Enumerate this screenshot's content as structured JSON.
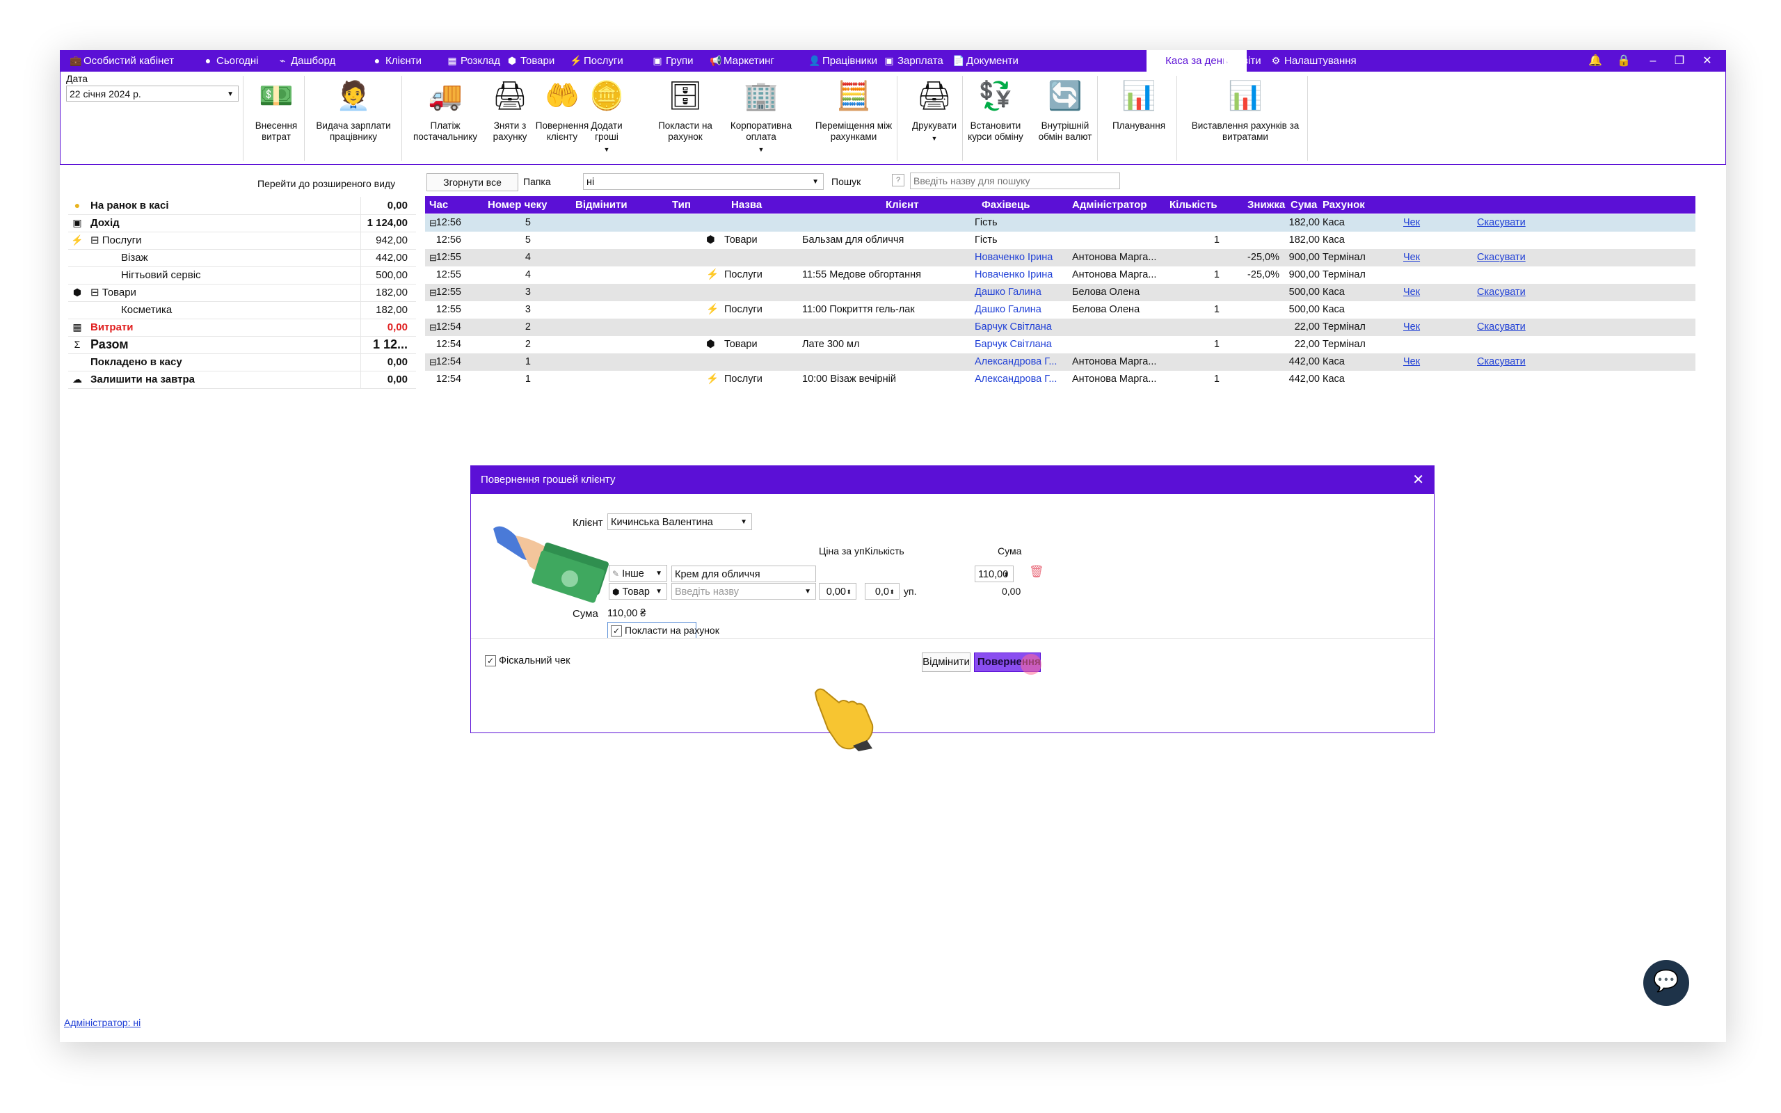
{
  "menubar": {
    "items": [
      {
        "icon": "briefcase-icon",
        "glyph": "💼",
        "label": "Особистий кабінет"
      },
      {
        "icon": "today-icon",
        "glyph": "●",
        "label": "Сьогодні"
      },
      {
        "icon": "pulse-icon",
        "glyph": "⌁",
        "label": "Дашборд"
      },
      {
        "icon": "user-circle-icon",
        "glyph": "●",
        "label": "Клієнти"
      },
      {
        "icon": "calendar-icon",
        "glyph": "▦",
        "label": "Розклад"
      },
      {
        "icon": "box-icon",
        "glyph": "⬢",
        "label": "Товари"
      },
      {
        "icon": "lightning-icon",
        "glyph": "⚡",
        "label": "Послуги"
      },
      {
        "icon": "groups-icon",
        "glyph": "▣",
        "label": "Групи"
      },
      {
        "icon": "megaphone-icon",
        "glyph": "📢",
        "label": "Маркетинг"
      },
      {
        "icon": "person-icon",
        "glyph": "👤",
        "label": "Працівники"
      },
      {
        "icon": "money-icon",
        "glyph": "▣",
        "label": "Зарплата"
      },
      {
        "icon": "document-icon",
        "glyph": "📄",
        "label": "Документи"
      },
      {
        "icon": "",
        "glyph": "",
        "label": "Каса за день"
      },
      {
        "icon": "bar-chart-icon",
        "glyph": "▮▮",
        "label": "Звіти"
      },
      {
        "icon": "gear-icon",
        "glyph": "⚙",
        "label": "Налаштування"
      }
    ],
    "active_index": 12
  },
  "toolbar": {
    "date_label": "Дата",
    "date_value": "22 січня 2024 р.",
    "buttons": [
      {
        "name": "add-expense-button",
        "icon": "cash-icon",
        "glyph": "💵",
        "label": "Внесення витрат",
        "caret": false
      },
      {
        "name": "pay-salary-button",
        "icon": "worker-pay-icon",
        "glyph": "🧑‍💼",
        "label": "Видача зарплати працівнику",
        "caret": false
      },
      {
        "name": "supplier-payment-button",
        "icon": "truck-icon",
        "glyph": "🚚",
        "label": "Платіж постачальнику",
        "caret": false
      },
      {
        "name": "withdraw-button",
        "icon": "register-icon",
        "glyph": "🖨",
        "label": "Зняти з рахунку",
        "caret": false
      },
      {
        "name": "refund-client-button",
        "icon": "refund-hand-icon",
        "glyph": "🤲",
        "label": "Повернення клієнту",
        "caret": false
      },
      {
        "name": "add-money-button",
        "icon": "coins-icon",
        "glyph": "🪙",
        "label": "Додати гроші",
        "caret": true
      },
      {
        "name": "deposit-button",
        "icon": "safe-icon",
        "glyph": "🗄",
        "label": "Покласти на рахунок",
        "caret": false
      },
      {
        "name": "corporate-payment-button",
        "icon": "building-icon",
        "glyph": "🏢",
        "label": "Корпоративна оплата",
        "caret": true
      },
      {
        "name": "transfer-accounts-button",
        "icon": "calculator-icon",
        "glyph": "🧮",
        "label": "Переміщення між рахунками",
        "caret": false
      },
      {
        "name": "print-button",
        "icon": "printer-icon",
        "glyph": "🖨",
        "label": "Друкувати",
        "caret": true
      },
      {
        "name": "set-exchange-rates-button",
        "icon": "exchange-rate-icon",
        "glyph": "💱",
        "label": "Встановити курси обміну",
        "caret": false
      },
      {
        "name": "internal-exchange-button",
        "icon": "currency-exchange-icon",
        "glyph": "🔄",
        "label": "Внутрішній обмін валют",
        "caret": false
      },
      {
        "name": "planning-button",
        "icon": "bar-chart-icon",
        "glyph": "📊",
        "label": "Планування",
        "caret": false
      },
      {
        "name": "expense-invoices-button",
        "icon": "bar-chart-icon",
        "glyph": "📊",
        "label": "Виставлення рахунків за витратами",
        "caret": false
      }
    ]
  },
  "subbar": {
    "advanced_view": "Перейти до розширеного виду",
    "collapse_all": "Згорнути все",
    "folder_label": "Папка",
    "folder_value": "ні",
    "search_label": "Пошук",
    "search_placeholder": "Введіть назву для пошуку"
  },
  "summary": [
    {
      "icon": "coin-icon",
      "glyph": "●",
      "label": "На ранок в касі",
      "value": "0,00",
      "bold": true,
      "red": false,
      "indent": 0,
      "big": false
    },
    {
      "icon": "cash-icon",
      "glyph": "▣",
      "label": "Дохід",
      "value": "1 124,00",
      "bold": true,
      "red": false,
      "indent": 0,
      "big": false
    },
    {
      "icon": "lightning-icon",
      "glyph": "⚡",
      "label": "⊟ Послуги",
      "value": "942,00",
      "bold": false,
      "red": false,
      "indent": 0,
      "big": false
    },
    {
      "icon": "",
      "glyph": "",
      "label": "Візаж",
      "value": "442,00",
      "bold": false,
      "red": false,
      "indent": 2,
      "big": false
    },
    {
      "icon": "",
      "glyph": "",
      "label": "Нігтьовий сервіс",
      "value": "500,00",
      "bold": false,
      "red": false,
      "indent": 2,
      "big": false
    },
    {
      "icon": "box-icon",
      "glyph": "⬢",
      "label": "⊟ Товари",
      "value": "182,00",
      "bold": false,
      "red": false,
      "indent": 0,
      "big": false
    },
    {
      "icon": "",
      "glyph": "",
      "label": "Косметика",
      "value": "182,00",
      "bold": false,
      "red": false,
      "indent": 2,
      "big": false
    },
    {
      "icon": "calculator-icon",
      "glyph": "▦",
      "label": "Витрати",
      "value": "0,00",
      "bold": true,
      "red": true,
      "indent": 0,
      "big": false
    },
    {
      "icon": "sigma-icon",
      "glyph": "Σ",
      "label": "Разом",
      "value": "1 12...",
      "bold": true,
      "red": false,
      "indent": 0,
      "big": true
    },
    {
      "icon": "",
      "glyph": "",
      "label": "Покладено в касу",
      "value": "0,00",
      "bold": true,
      "red": false,
      "indent": 0,
      "big": false
    },
    {
      "icon": "cloud-icon",
      "glyph": "☁",
      "label": "Залишити на завтра",
      "value": "0,00",
      "bold": true,
      "red": false,
      "indent": 0,
      "big": false
    }
  ],
  "grid": {
    "columns": [
      "Час",
      "Номер чеку",
      "Відмінити",
      "Тип",
      "Назва",
      "Клієнт",
      "Фахівець",
      "Адміністратор",
      "Кількість",
      "Знижка",
      "Сума",
      "Рахунок"
    ],
    "rows": [
      {
        "group": true,
        "sel": true,
        "time": "12:56",
        "num": "5",
        "typeIcon": "",
        "type": "",
        "name": "",
        "client": "Гість",
        "clientLink": false,
        "specialist": "",
        "qty": "",
        "disc": "",
        "sum": "182,00",
        "acct": "Каса",
        "chek": "Чек",
        "cancel": "Скасувати"
      },
      {
        "group": false,
        "sel": false,
        "time": "12:56",
        "num": "5",
        "typeIcon": "⬢",
        "type": "Товари",
        "name": "Бальзам для обличчя",
        "client": "Гість",
        "clientLink": false,
        "specialist": "",
        "qty": "1",
        "disc": "",
        "sum": "182,00",
        "acct": "Каса",
        "chek": "",
        "cancel": ""
      },
      {
        "group": true,
        "sel": false,
        "time": "12:55",
        "num": "4",
        "typeIcon": "",
        "type": "",
        "name": "",
        "client": "Новаченко Ірина",
        "clientLink": true,
        "specialist": "Антонова Марга...",
        "qty": "",
        "disc": "-25,0%",
        "sum": "900,00",
        "acct": "Термінал",
        "chek": "Чек",
        "cancel": "Скасувати"
      },
      {
        "group": false,
        "sel": false,
        "time": "12:55",
        "num": "4",
        "typeIcon": "⚡",
        "type": "Послуги",
        "name": "11:55 Медове обгортання",
        "client": "Новаченко Ірина",
        "clientLink": true,
        "specialist": "Антонова Марга...",
        "qty": "1",
        "disc": "-25,0%",
        "sum": "900,00",
        "acct": "Термінал",
        "chek": "",
        "cancel": ""
      },
      {
        "group": true,
        "sel": false,
        "time": "12:55",
        "num": "3",
        "typeIcon": "",
        "type": "",
        "name": "",
        "client": "Дашко Галина",
        "clientLink": true,
        "specialist": "Белова Олена",
        "qty": "",
        "disc": "",
        "sum": "500,00",
        "acct": "Каса",
        "chek": "Чек",
        "cancel": "Скасувати"
      },
      {
        "group": false,
        "sel": false,
        "time": "12:55",
        "num": "3",
        "typeIcon": "⚡",
        "type": "Послуги",
        "name": "11:00 Покриття гель-лак",
        "client": "Дашко Галина",
        "clientLink": true,
        "specialist": "Белова Олена",
        "qty": "1",
        "disc": "",
        "sum": "500,00",
        "acct": "Каса",
        "chek": "",
        "cancel": ""
      },
      {
        "group": true,
        "sel": false,
        "time": "12:54",
        "num": "2",
        "typeIcon": "",
        "type": "",
        "name": "",
        "client": "Барчук Світлана",
        "clientLink": true,
        "specialist": "",
        "qty": "",
        "disc": "",
        "sum": "22,00",
        "acct": "Термінал",
        "chek": "Чек",
        "cancel": "Скасувати"
      },
      {
        "group": false,
        "sel": false,
        "time": "12:54",
        "num": "2",
        "typeIcon": "⬢",
        "type": "Товари",
        "name": "Лате 300 мл",
        "client": "Барчук Світлана",
        "clientLink": true,
        "specialist": "",
        "qty": "1",
        "disc": "",
        "sum": "22,00",
        "acct": "Термінал",
        "chek": "",
        "cancel": ""
      },
      {
        "group": true,
        "sel": false,
        "time": "12:54",
        "num": "1",
        "typeIcon": "",
        "type": "",
        "name": "",
        "client": "Александрова Г...",
        "clientLink": true,
        "specialist": "Антонова Марга...",
        "qty": "",
        "disc": "",
        "sum": "442,00",
        "acct": "Каса",
        "chek": "Чек",
        "cancel": "Скасувати"
      },
      {
        "group": false,
        "sel": false,
        "time": "12:54",
        "num": "1",
        "typeIcon": "⚡",
        "type": "Послуги",
        "name": "10:00 Візаж вечірній",
        "client": "Александрова Г...",
        "clientLink": true,
        "specialist": "Антонова Марга...",
        "qty": "1",
        "disc": "",
        "sum": "442,00",
        "acct": "Каса",
        "chek": "",
        "cancel": ""
      }
    ]
  },
  "dialog": {
    "title": "Повернення грошей клієнту",
    "client_label": "Клієнт",
    "client_value": "Кичинська Валентина",
    "col_price": "Ціна за уп.",
    "col_qty": "Кількість",
    "col_sum": "Сума",
    "line1_type": "Інше",
    "line1_name": "Крем для обличчя",
    "line1_sum": "110,00",
    "line2_type": "Товар",
    "line2_placeholder": "Введіть назву",
    "line2_price": "0,00",
    "line2_qty": "0,0",
    "line2_unit": "уп.",
    "line2_sum": "0,00",
    "total_label": "Сума",
    "total_value": "110,00 ₴",
    "deposit_checkbox": "Покласти на рахунок",
    "fiscal_checkbox": "Фіскальний чек",
    "cancel_button": "Відмінити",
    "refund_button": "Повернення гр"
  },
  "footer": {
    "admin_link": "Адміністратор: ні"
  },
  "colors": {
    "accent": "#5b10d6",
    "link": "#1f3fd6",
    "red": "#e02020"
  }
}
